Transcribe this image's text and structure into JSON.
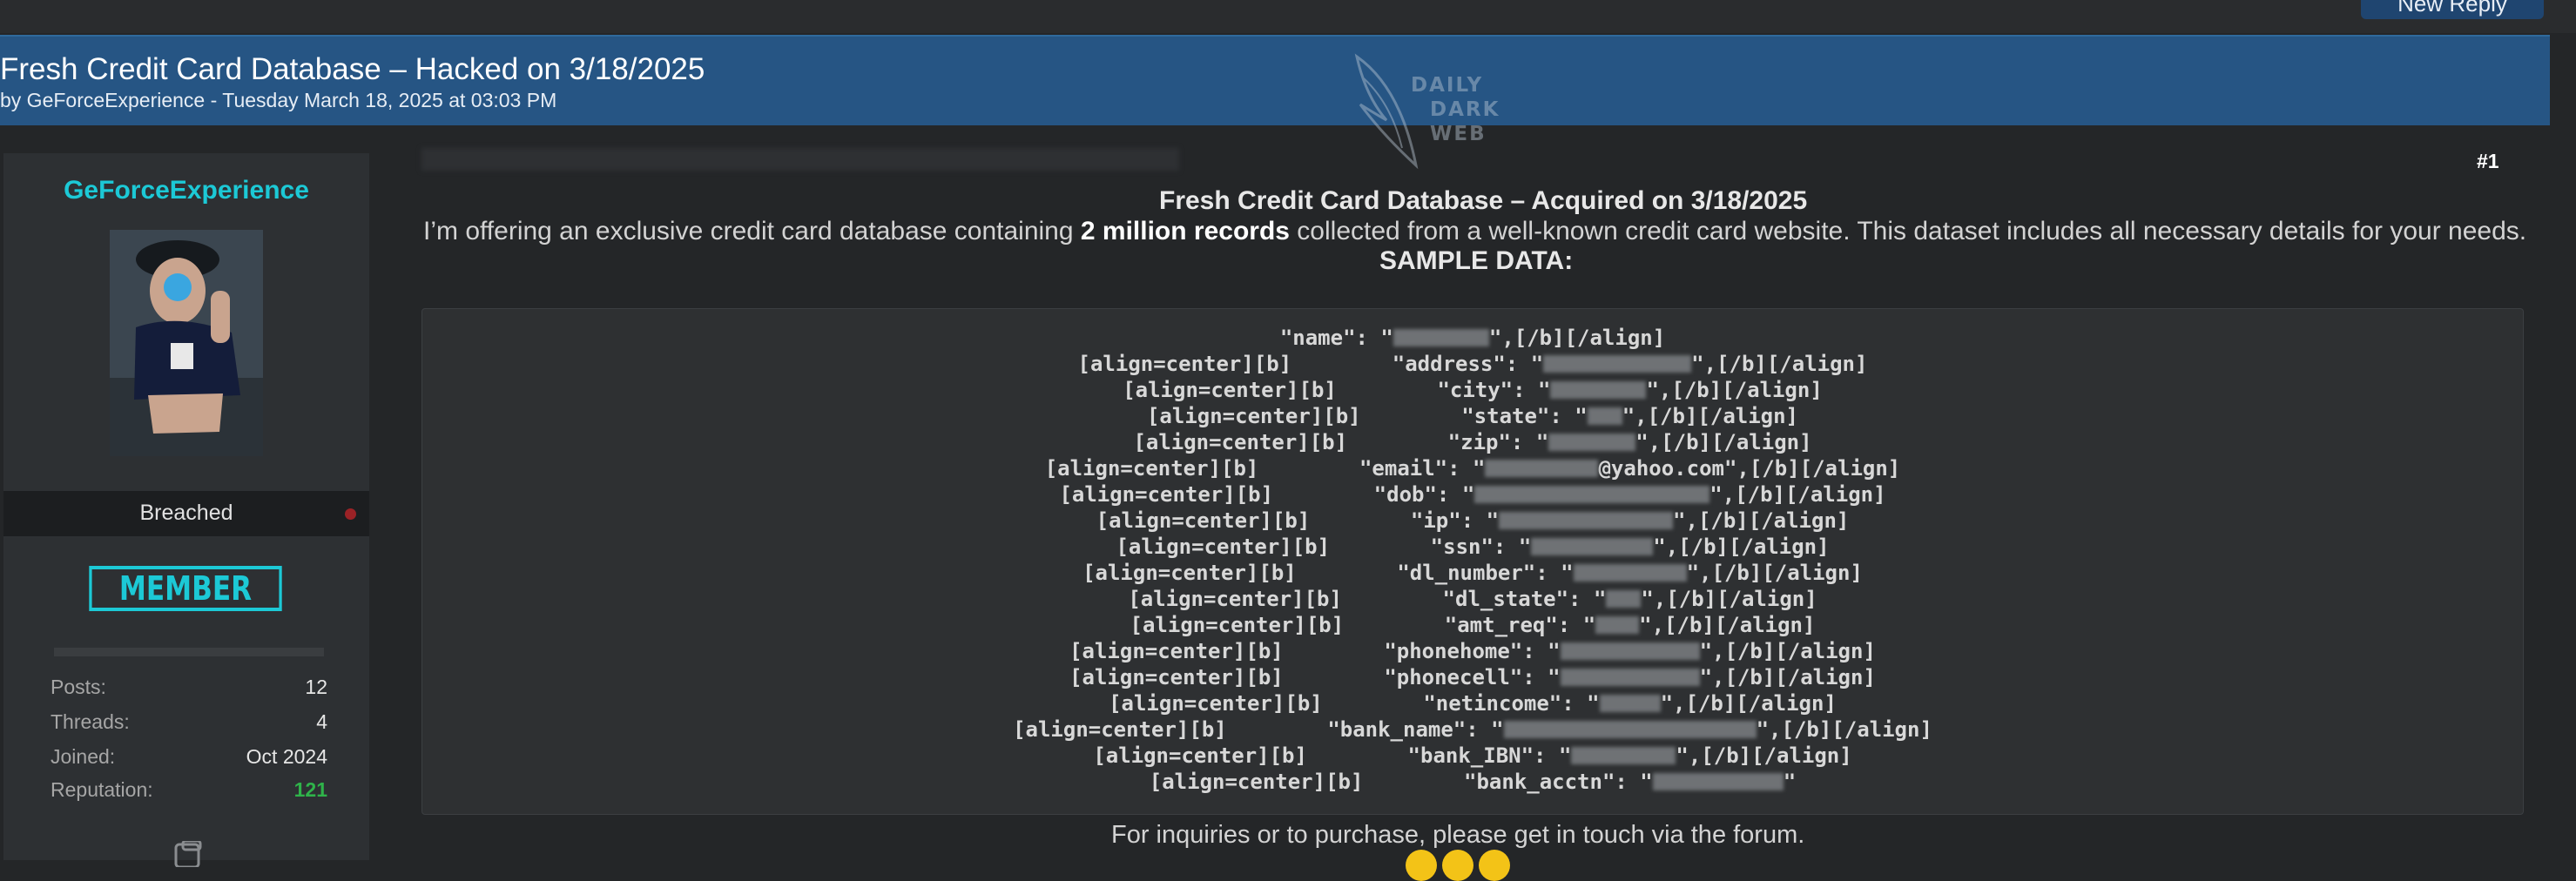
{
  "toolbar": {
    "new_reply_label": "New Reply"
  },
  "thread": {
    "title": "Fresh Credit Card Database – Hacked on 3/18/2025",
    "byline": "by GeForceExperience - Tuesday March 18, 2025 at 03:03 PM"
  },
  "watermark": {
    "lines": [
      "DAILY",
      "DARK",
      "WEB"
    ]
  },
  "author": {
    "username": "GeForceExperience",
    "rank": "Breached",
    "badge": "MEMBER",
    "stats": [
      {
        "label": "Posts:",
        "value": "12"
      },
      {
        "label": "Threads:",
        "value": "4"
      },
      {
        "label": "Joined:",
        "value": "Oct 2024"
      },
      {
        "label": "Reputation:",
        "value": "121"
      }
    ]
  },
  "post": {
    "number": "#1",
    "title": "Fresh Credit Card Database – Acquired on 3/18/2025",
    "intro_before": "I’m offering an exclusive credit card database containing ",
    "intro_bold": "2 million records",
    "intro_after": " collected from a well-known credit card website. This dataset includes all necessary details for your needs.",
    "sample_heading": "SAMPLE DATA:",
    "code_lines": [
      {
        "prefix": "",
        "key": "\"name\": \"",
        "suffix": "\",[/b][/align]",
        "redacted_width": 110
      },
      {
        "prefix": "[align=center][b]        ",
        "key": "\"address\": \"",
        "suffix": "\",[/b][/align]",
        "redacted_width": 170
      },
      {
        "prefix": "[align=center][b]        ",
        "key": "\"city\": \"",
        "suffix": "\",[/b][/align]",
        "redacted_width": 110
      },
      {
        "prefix": "[align=center][b]        ",
        "key": "\"state\": \"",
        "suffix": "\",[/b][/align]",
        "redacted_width": 40
      },
      {
        "prefix": "[align=center][b]        ",
        "key": "\"zip\": \"",
        "suffix": "\",[/b][/align]",
        "redacted_width": 100
      },
      {
        "prefix": "[align=center][b]        ",
        "key": "\"email\": \"",
        "suffix": "@yahoo.com\",[/b][/align]",
        "redacted_width": 130
      },
      {
        "prefix": "[align=center][b]        ",
        "key": "\"dob\": \"",
        "suffix": "\",[/b][/align]",
        "redacted_width": 270
      },
      {
        "prefix": "[align=center][b]        ",
        "key": "\"ip\": \"",
        "suffix": "\",[/b][/align]",
        "redacted_width": 200
      },
      {
        "prefix": "[align=center][b]        ",
        "key": "\"ssn\": \"",
        "suffix": "\",[/b][/align]",
        "redacted_width": 140
      },
      {
        "prefix": "[align=center][b]        ",
        "key": "\"dl_number\": \"",
        "suffix": "\",[/b][/align]",
        "redacted_width": 130
      },
      {
        "prefix": "[align=center][b]        ",
        "key": "\"dl_state\": \"",
        "suffix": "\",[/b][/align]",
        "redacted_width": 40
      },
      {
        "prefix": "[align=center][b]        ",
        "key": "\"amt_req\": \"",
        "suffix": "\",[/b][/align]",
        "redacted_width": 50
      },
      {
        "prefix": "[align=center][b]        ",
        "key": "\"phonehome\": \"",
        "suffix": "\",[/b][/align]",
        "redacted_width": 160
      },
      {
        "prefix": "[align=center][b]        ",
        "key": "\"phonecell\": \"",
        "suffix": "\",[/b][/align]",
        "redacted_width": 160
      },
      {
        "prefix": "[align=center][b]        ",
        "key": "\"netincome\": \"",
        "suffix": "\",[/b][/align]",
        "redacted_width": 70
      },
      {
        "prefix": "[align=center][b]        ",
        "key": "\"bank_name\": \"",
        "suffix": "\",[/b][/align]",
        "redacted_width": 290
      },
      {
        "prefix": "[align=center][b]        ",
        "key": "\"bank_IBN\": \"",
        "suffix": "\",[/b][/align]",
        "redacted_width": 120
      },
      {
        "prefix": "[align=center][b]        ",
        "key": "\"bank_acctn\": \"",
        "suffix": "\"",
        "redacted_width": 150
      }
    ],
    "footer": "For inquiries or to purchase, please get in touch via the forum."
  }
}
